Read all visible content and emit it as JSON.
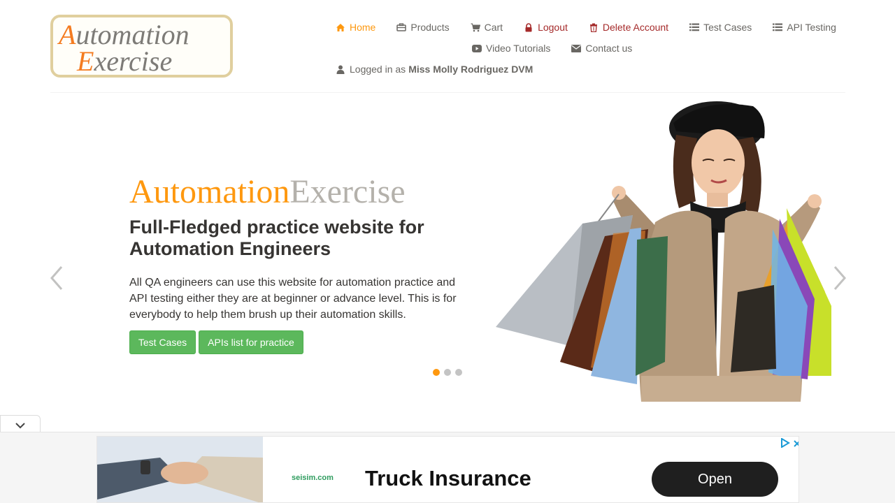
{
  "logo": {
    "line1": "Automation",
    "line2": "Exercise"
  },
  "nav": {
    "home": "Home",
    "products": "Products",
    "cart": "Cart",
    "logout": "Logout",
    "delete_account": "Delete Account",
    "test_cases": "Test Cases",
    "api_testing": "API Testing",
    "video_tutorials": "Video Tutorials",
    "contact_us": "Contact us",
    "logged_in_prefix": "Logged in as",
    "username": "Miss Molly Rodriguez DVM"
  },
  "slider": {
    "brand_a": "Automation",
    "brand_b": "Exercise",
    "headline": "Full-Fledged practice website for Automation Engineers",
    "description": "All QA engineers can use this website for automation practice and API testing either they are at beginner or advance level. This is for everybody to help them brush up their automation skills.",
    "button_test_cases": "Test Cases",
    "button_apis": "APIs list for practice",
    "active_slide": 1,
    "slide_count": 3
  },
  "ad": {
    "logo_text": "seisim.com",
    "title": "Truck Insurance",
    "open_label": "Open"
  },
  "colors": {
    "accent": "#fe980f",
    "danger": "#a52a2a",
    "button_green": "#5cb85c",
    "text": "#696763"
  },
  "icons": {
    "home": "home-icon",
    "products": "products-icon",
    "cart": "cart-icon",
    "logout": "lock-icon",
    "delete": "trash-icon",
    "test_cases": "list-icon",
    "api": "list-icon",
    "video": "youtube-play-icon",
    "contact": "envelope-icon",
    "user": "user-icon"
  }
}
